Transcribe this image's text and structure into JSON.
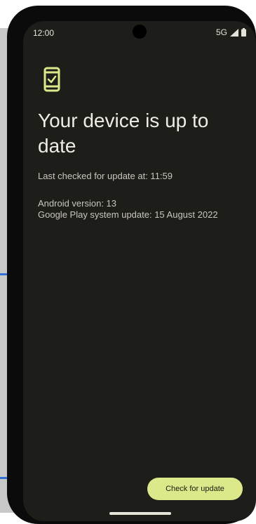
{
  "status_bar": {
    "time": "12:00",
    "network": "5G"
  },
  "icons": {
    "status": [
      "signal-icon",
      "battery-icon"
    ],
    "header": "phone-check-icon"
  },
  "content": {
    "title": "Your device is up to date",
    "last_checked": "Last checked for update at: 11:59",
    "android_version": "Android version: 13",
    "play_system_update": "Google Play system update: 15 August 2022"
  },
  "actions": {
    "check_update_label": "Check for update"
  },
  "colors": {
    "screen_background": "#1d1d19",
    "accent": "#dce88a",
    "text_primary": "#eeece3",
    "text_secondary": "#c9c7bd"
  }
}
